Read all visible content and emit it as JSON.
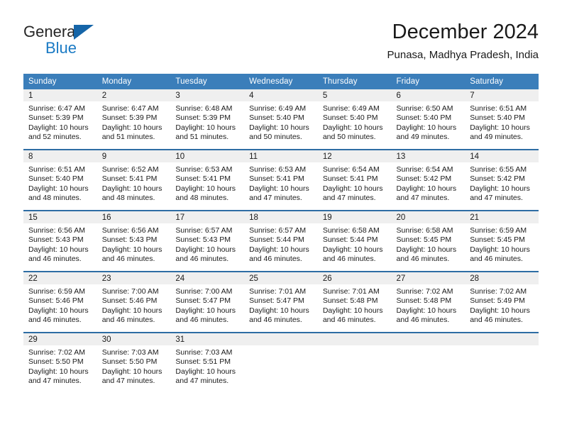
{
  "brand": {
    "word_one": "General",
    "word_two": "Blue",
    "triangle_color": "#1565a8",
    "blue_color": "#1a7ac4"
  },
  "header": {
    "title": "December 2024",
    "subtitle": "Punasa, Madhya Pradesh, India"
  },
  "theme": {
    "header_blue": "#3b7eba",
    "row_rule_blue": "#2e6da4",
    "daynum_bg": "#efefef"
  },
  "calendar": {
    "weekday_headers": [
      "Sunday",
      "Monday",
      "Tuesday",
      "Wednesday",
      "Thursday",
      "Friday",
      "Saturday"
    ],
    "weeks": [
      [
        {
          "day": "1",
          "sunrise": "Sunrise: 6:47 AM",
          "sunset": "Sunset: 5:39 PM",
          "daylight_1": "Daylight: 10 hours",
          "daylight_2": "and 52 minutes."
        },
        {
          "day": "2",
          "sunrise": "Sunrise: 6:47 AM",
          "sunset": "Sunset: 5:39 PM",
          "daylight_1": "Daylight: 10 hours",
          "daylight_2": "and 51 minutes."
        },
        {
          "day": "3",
          "sunrise": "Sunrise: 6:48 AM",
          "sunset": "Sunset: 5:39 PM",
          "daylight_1": "Daylight: 10 hours",
          "daylight_2": "and 51 minutes."
        },
        {
          "day": "4",
          "sunrise": "Sunrise: 6:49 AM",
          "sunset": "Sunset: 5:40 PM",
          "daylight_1": "Daylight: 10 hours",
          "daylight_2": "and 50 minutes."
        },
        {
          "day": "5",
          "sunrise": "Sunrise: 6:49 AM",
          "sunset": "Sunset: 5:40 PM",
          "daylight_1": "Daylight: 10 hours",
          "daylight_2": "and 50 minutes."
        },
        {
          "day": "6",
          "sunrise": "Sunrise: 6:50 AM",
          "sunset": "Sunset: 5:40 PM",
          "daylight_1": "Daylight: 10 hours",
          "daylight_2": "and 49 minutes."
        },
        {
          "day": "7",
          "sunrise": "Sunrise: 6:51 AM",
          "sunset": "Sunset: 5:40 PM",
          "daylight_1": "Daylight: 10 hours",
          "daylight_2": "and 49 minutes."
        }
      ],
      [
        {
          "day": "8",
          "sunrise": "Sunrise: 6:51 AM",
          "sunset": "Sunset: 5:40 PM",
          "daylight_1": "Daylight: 10 hours",
          "daylight_2": "and 48 minutes."
        },
        {
          "day": "9",
          "sunrise": "Sunrise: 6:52 AM",
          "sunset": "Sunset: 5:41 PM",
          "daylight_1": "Daylight: 10 hours",
          "daylight_2": "and 48 minutes."
        },
        {
          "day": "10",
          "sunrise": "Sunrise: 6:53 AM",
          "sunset": "Sunset: 5:41 PM",
          "daylight_1": "Daylight: 10 hours",
          "daylight_2": "and 48 minutes."
        },
        {
          "day": "11",
          "sunrise": "Sunrise: 6:53 AM",
          "sunset": "Sunset: 5:41 PM",
          "daylight_1": "Daylight: 10 hours",
          "daylight_2": "and 47 minutes."
        },
        {
          "day": "12",
          "sunrise": "Sunrise: 6:54 AM",
          "sunset": "Sunset: 5:41 PM",
          "daylight_1": "Daylight: 10 hours",
          "daylight_2": "and 47 minutes."
        },
        {
          "day": "13",
          "sunrise": "Sunrise: 6:54 AM",
          "sunset": "Sunset: 5:42 PM",
          "daylight_1": "Daylight: 10 hours",
          "daylight_2": "and 47 minutes."
        },
        {
          "day": "14",
          "sunrise": "Sunrise: 6:55 AM",
          "sunset": "Sunset: 5:42 PM",
          "daylight_1": "Daylight: 10 hours",
          "daylight_2": "and 47 minutes."
        }
      ],
      [
        {
          "day": "15",
          "sunrise": "Sunrise: 6:56 AM",
          "sunset": "Sunset: 5:43 PM",
          "daylight_1": "Daylight: 10 hours",
          "daylight_2": "and 46 minutes."
        },
        {
          "day": "16",
          "sunrise": "Sunrise: 6:56 AM",
          "sunset": "Sunset: 5:43 PM",
          "daylight_1": "Daylight: 10 hours",
          "daylight_2": "and 46 minutes."
        },
        {
          "day": "17",
          "sunrise": "Sunrise: 6:57 AM",
          "sunset": "Sunset: 5:43 PM",
          "daylight_1": "Daylight: 10 hours",
          "daylight_2": "and 46 minutes."
        },
        {
          "day": "18",
          "sunrise": "Sunrise: 6:57 AM",
          "sunset": "Sunset: 5:44 PM",
          "daylight_1": "Daylight: 10 hours",
          "daylight_2": "and 46 minutes."
        },
        {
          "day": "19",
          "sunrise": "Sunrise: 6:58 AM",
          "sunset": "Sunset: 5:44 PM",
          "daylight_1": "Daylight: 10 hours",
          "daylight_2": "and 46 minutes."
        },
        {
          "day": "20",
          "sunrise": "Sunrise: 6:58 AM",
          "sunset": "Sunset: 5:45 PM",
          "daylight_1": "Daylight: 10 hours",
          "daylight_2": "and 46 minutes."
        },
        {
          "day": "21",
          "sunrise": "Sunrise: 6:59 AM",
          "sunset": "Sunset: 5:45 PM",
          "daylight_1": "Daylight: 10 hours",
          "daylight_2": "and 46 minutes."
        }
      ],
      [
        {
          "day": "22",
          "sunrise": "Sunrise: 6:59 AM",
          "sunset": "Sunset: 5:46 PM",
          "daylight_1": "Daylight: 10 hours",
          "daylight_2": "and 46 minutes."
        },
        {
          "day": "23",
          "sunrise": "Sunrise: 7:00 AM",
          "sunset": "Sunset: 5:46 PM",
          "daylight_1": "Daylight: 10 hours",
          "daylight_2": "and 46 minutes."
        },
        {
          "day": "24",
          "sunrise": "Sunrise: 7:00 AM",
          "sunset": "Sunset: 5:47 PM",
          "daylight_1": "Daylight: 10 hours",
          "daylight_2": "and 46 minutes."
        },
        {
          "day": "25",
          "sunrise": "Sunrise: 7:01 AM",
          "sunset": "Sunset: 5:47 PM",
          "daylight_1": "Daylight: 10 hours",
          "daylight_2": "and 46 minutes."
        },
        {
          "day": "26",
          "sunrise": "Sunrise: 7:01 AM",
          "sunset": "Sunset: 5:48 PM",
          "daylight_1": "Daylight: 10 hours",
          "daylight_2": "and 46 minutes."
        },
        {
          "day": "27",
          "sunrise": "Sunrise: 7:02 AM",
          "sunset": "Sunset: 5:48 PM",
          "daylight_1": "Daylight: 10 hours",
          "daylight_2": "and 46 minutes."
        },
        {
          "day": "28",
          "sunrise": "Sunrise: 7:02 AM",
          "sunset": "Sunset: 5:49 PM",
          "daylight_1": "Daylight: 10 hours",
          "daylight_2": "and 46 minutes."
        }
      ],
      [
        {
          "day": "29",
          "sunrise": "Sunrise: 7:02 AM",
          "sunset": "Sunset: 5:50 PM",
          "daylight_1": "Daylight: 10 hours",
          "daylight_2": "and 47 minutes."
        },
        {
          "day": "30",
          "sunrise": "Sunrise: 7:03 AM",
          "sunset": "Sunset: 5:50 PM",
          "daylight_1": "Daylight: 10 hours",
          "daylight_2": "and 47 minutes."
        },
        {
          "day": "31",
          "sunrise": "Sunrise: 7:03 AM",
          "sunset": "Sunset: 5:51 PM",
          "daylight_1": "Daylight: 10 hours",
          "daylight_2": "and 47 minutes."
        },
        {
          "day": "",
          "sunrise": "",
          "sunset": "",
          "daylight_1": "",
          "daylight_2": ""
        },
        {
          "day": "",
          "sunrise": "",
          "sunset": "",
          "daylight_1": "",
          "daylight_2": ""
        },
        {
          "day": "",
          "sunrise": "",
          "sunset": "",
          "daylight_1": "",
          "daylight_2": ""
        },
        {
          "day": "",
          "sunrise": "",
          "sunset": "",
          "daylight_1": "",
          "daylight_2": ""
        }
      ]
    ]
  }
}
